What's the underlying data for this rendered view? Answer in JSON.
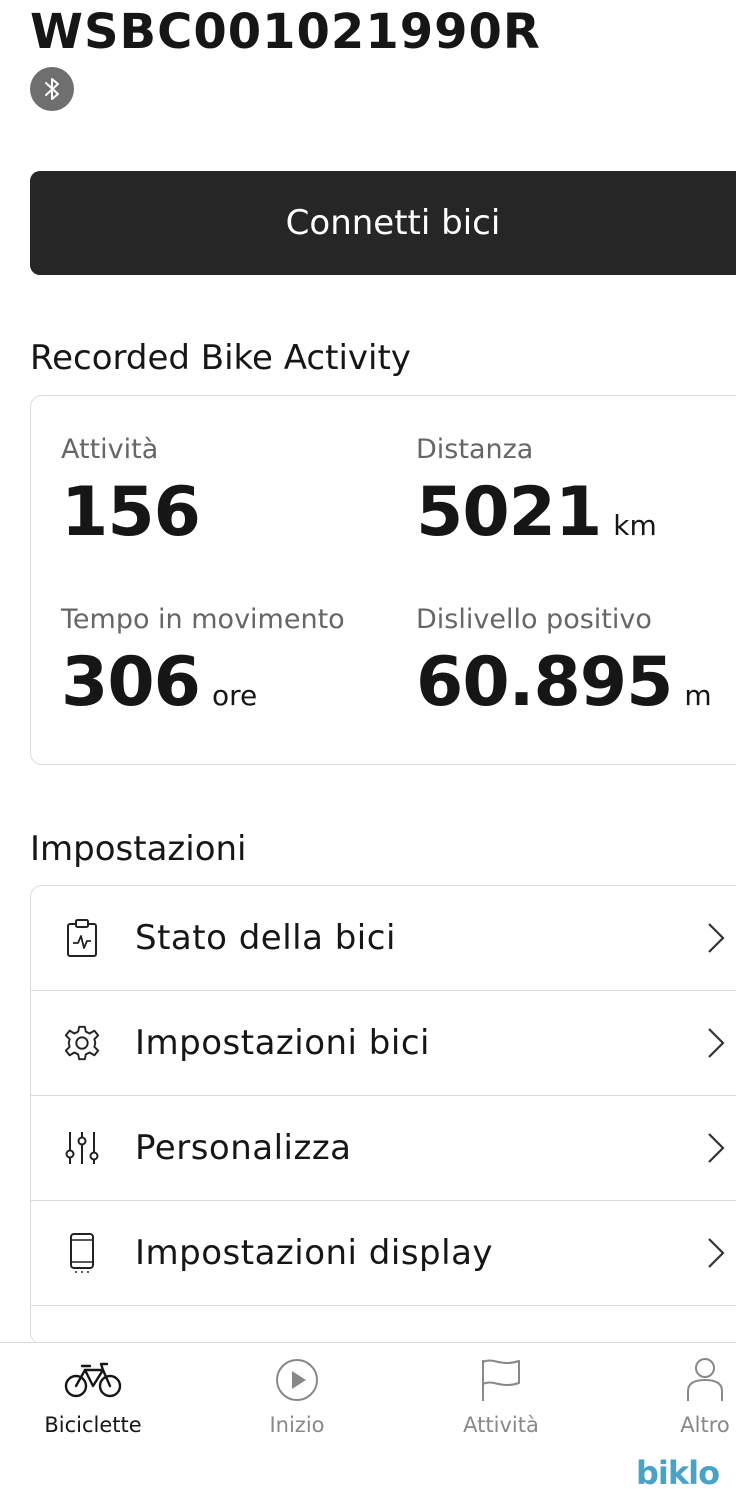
{
  "bike": {
    "serial": "WSBC001021990R",
    "bluetooth_icon": "bluetooth-icon"
  },
  "connect_button_label": "Connetti bici",
  "activity": {
    "title": "Recorded Bike Activity",
    "stats": {
      "activities": {
        "label": "Attività",
        "value": "156",
        "unit": ""
      },
      "distance": {
        "label": "Distanza",
        "value": "5021",
        "unit": "km"
      },
      "moving_time": {
        "label": "Tempo in movimento",
        "value": "306",
        "unit": "ore"
      },
      "elevation": {
        "label": "Dislivello positivo",
        "value": "60.895",
        "unit": "m"
      }
    }
  },
  "settings": {
    "title": "Impostazioni",
    "items": [
      {
        "label": "Stato della bici",
        "icon": "clipboard-pulse-icon"
      },
      {
        "label": "Impostazioni bici",
        "icon": "gear-icon"
      },
      {
        "label": "Personalizza",
        "icon": "sliders-icon"
      },
      {
        "label": "Impostazioni display",
        "icon": "phone-display-icon"
      }
    ]
  },
  "tabbar": {
    "tabs": [
      {
        "label": "Biciclette",
        "icon": "bicycle-icon",
        "active": true
      },
      {
        "label": "Inizio",
        "icon": "play-circle-icon",
        "active": false
      },
      {
        "label": "Attività",
        "icon": "flag-icon",
        "active": false
      },
      {
        "label": "Altro",
        "icon": "person-icon",
        "active": false
      }
    ]
  },
  "watermark": "biklo",
  "colors": {
    "button_bg": "#262626",
    "badge_bg": "#6f6f6f",
    "muted_text": "#666666",
    "watermark": "#4aa3c7"
  }
}
